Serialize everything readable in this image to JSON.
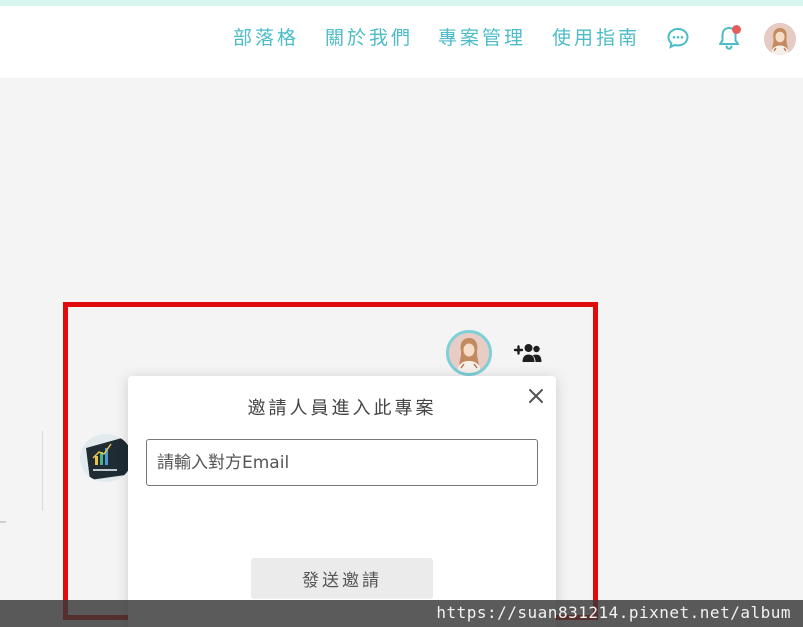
{
  "header": {
    "nav_items": [
      {
        "label": "部落格"
      },
      {
        "label": "關於我們"
      },
      {
        "label": "專案管理"
      },
      {
        "label": "使用指南"
      }
    ],
    "icons": [
      "chat-icon",
      "bell-icon",
      "user-avatar"
    ],
    "notification_dot_color": "#e35d5d"
  },
  "project": {
    "member_icons": [
      "member-avatar",
      "add-member-icon"
    ]
  },
  "invite_modal": {
    "title": "邀請人員進入此專案",
    "email_placeholder": "請輸入對方Email",
    "email_value": "",
    "send_label": "發送邀請",
    "close_icon": "close-icon"
  },
  "watermark": {
    "text": "https://suan831214.pixnet.net/album"
  },
  "colors": {
    "accent": "#4cbcc8",
    "highlight": "#e00b0b",
    "top_strip": "#d6f6ef",
    "page_background": "#f4f4f4"
  }
}
